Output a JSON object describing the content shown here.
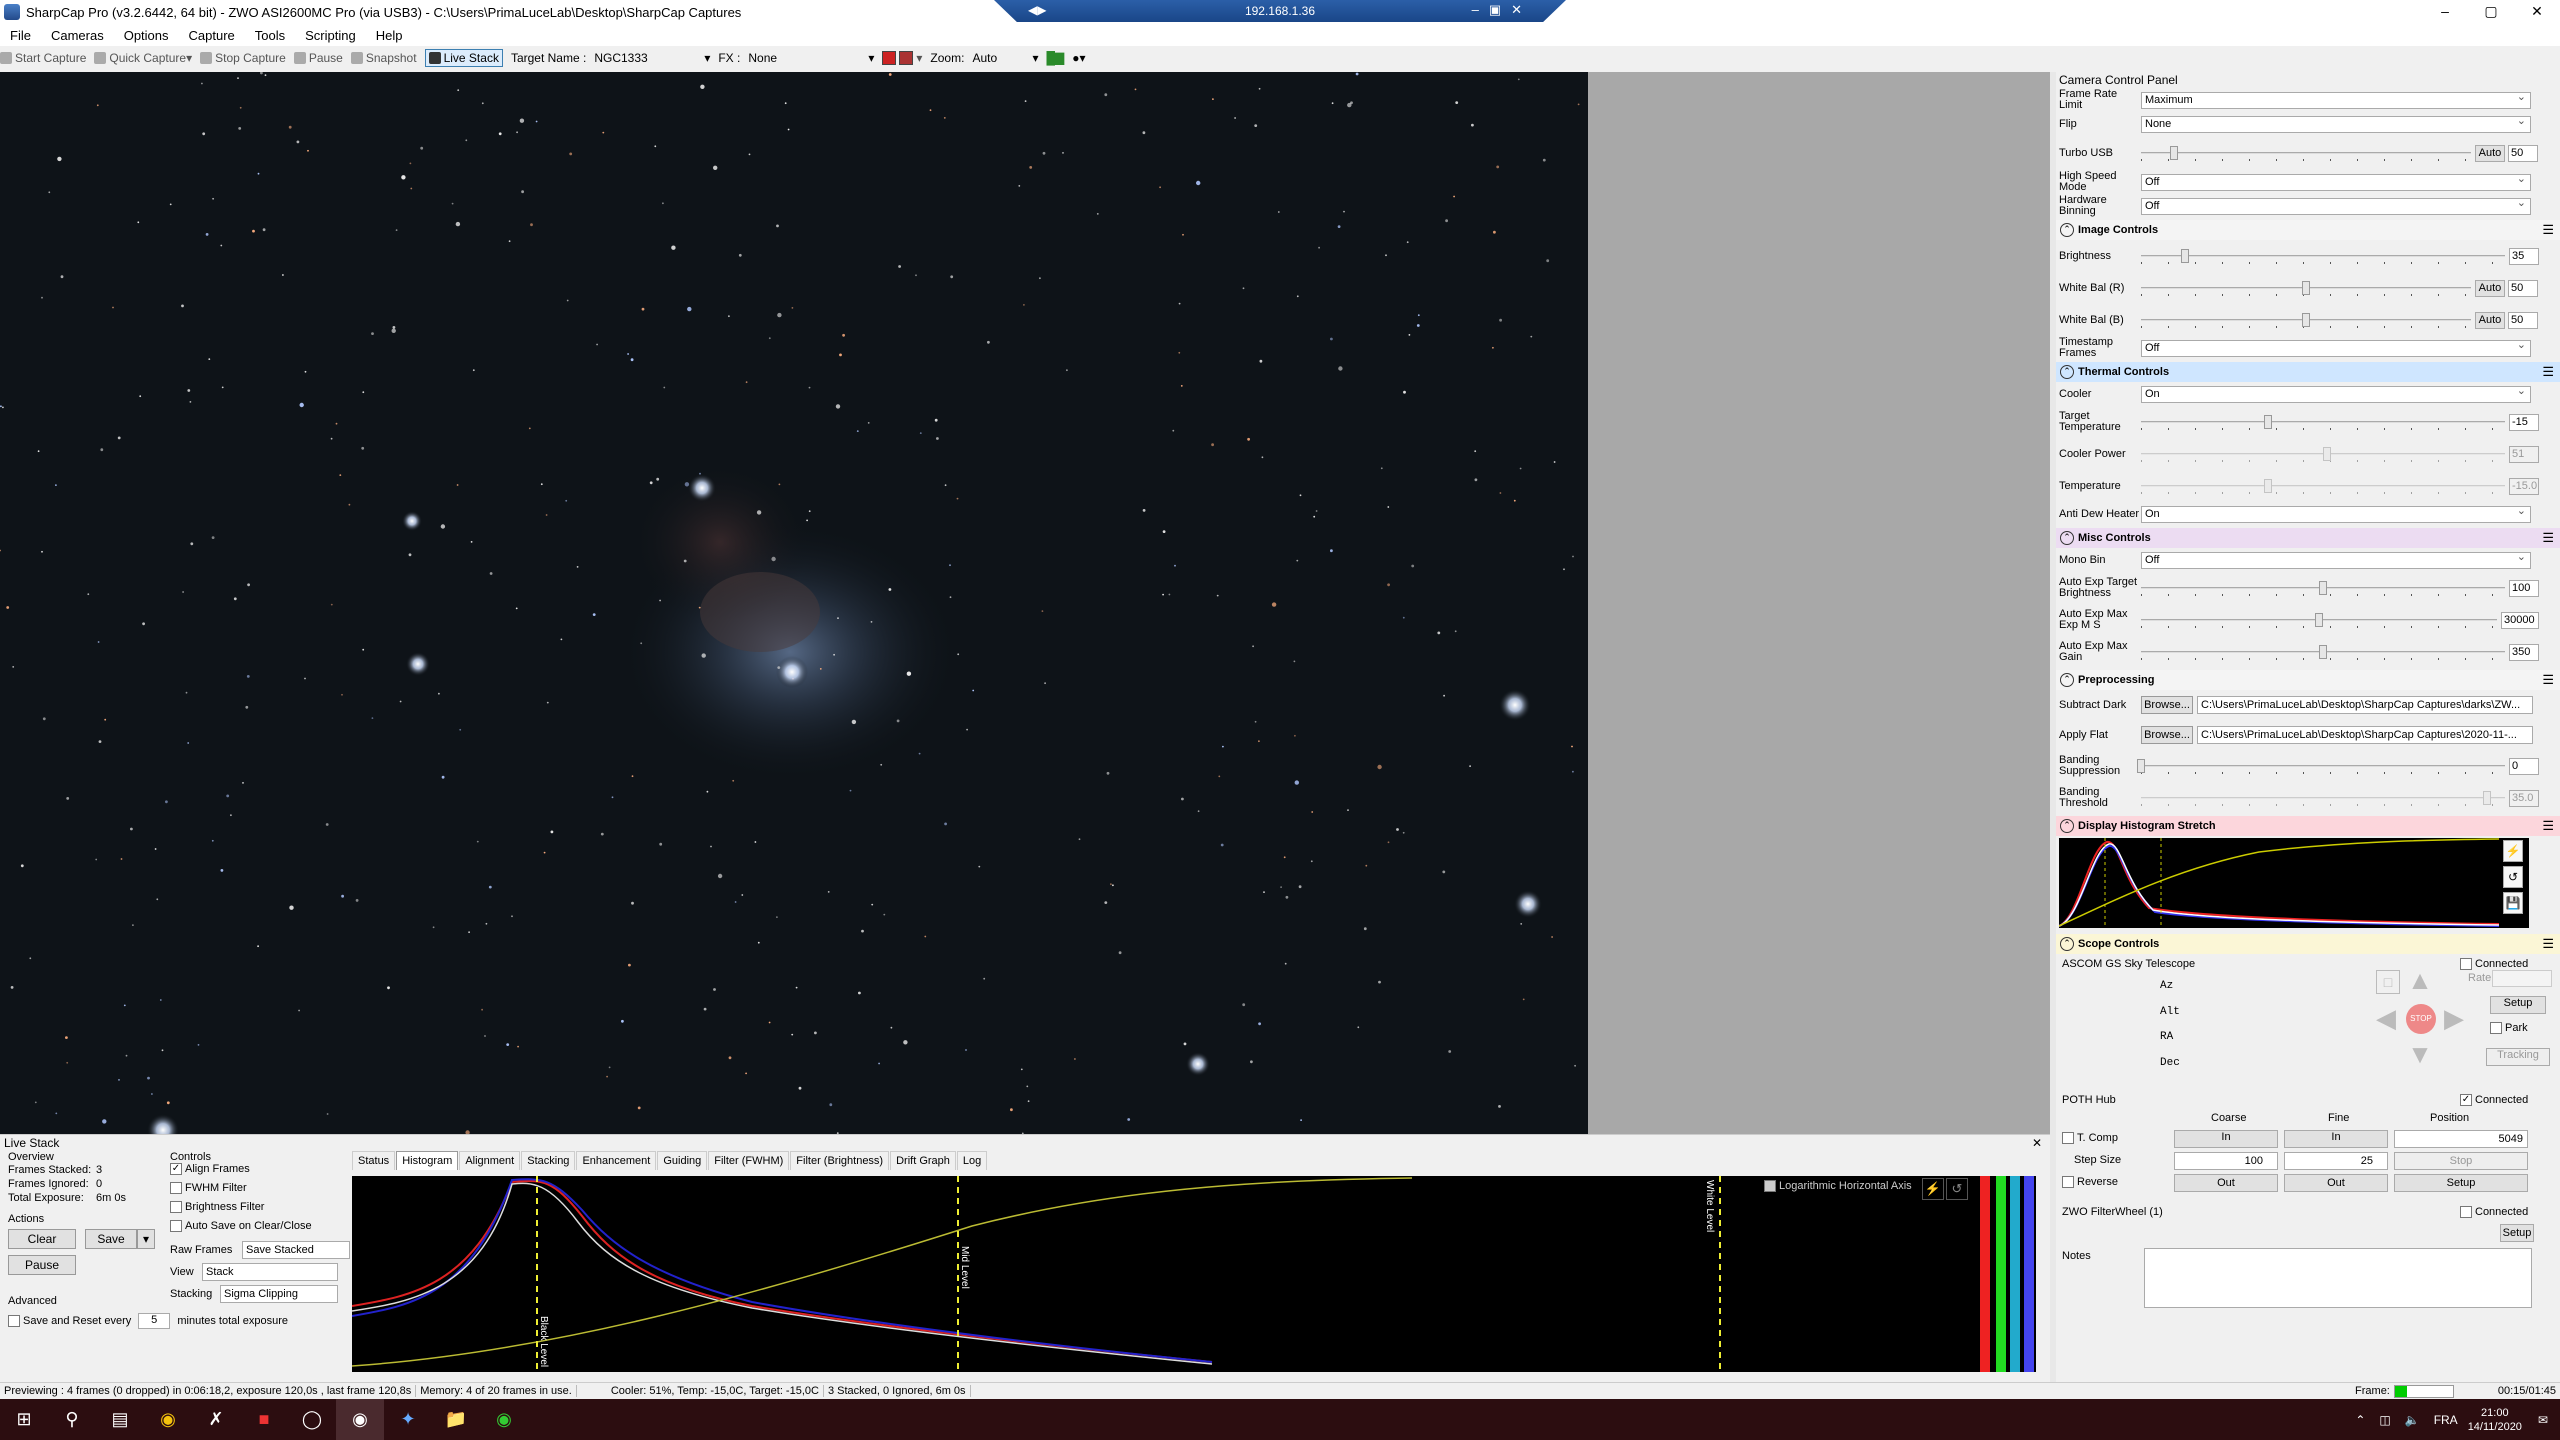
{
  "window": {
    "title": "SharpCap Pro (v3.2.6442, 64 bit) - ZWO ASI2600MC Pro (via USB3) - C:\\Users\\PrimaLuceLab\\Desktop\\SharpCap Captures",
    "remote_address": "192.168.1.36"
  },
  "menu": [
    "File",
    "Cameras",
    "Options",
    "Capture",
    "Tools",
    "Scripting",
    "Help"
  ],
  "toolbar": {
    "start_capture": "Start Capture",
    "quick_capture": "Quick Capture",
    "stop_capture": "Stop Capture",
    "pause": "Pause",
    "snapshot": "Snapshot",
    "live_stack": "Live Stack",
    "target_name_label": "Target Name :",
    "target_name_value": "NGC1333",
    "fx_label": "FX :",
    "fx_value": "None",
    "zoom_label": "Zoom:",
    "zoom_value": "Auto"
  },
  "ccp": {
    "title": "Camera Control Panel",
    "camera_rows": [
      {
        "label": "Frame Rate Limit",
        "value": "Maximum"
      },
      {
        "label": "Flip",
        "value": "None"
      }
    ],
    "turbo_usb": {
      "label": "Turbo USB",
      "auto": "Auto",
      "value": "50",
      "level": 0.1
    },
    "high_speed": {
      "label": "High Speed Mode",
      "value": "Off"
    },
    "hw_binning": {
      "label": "Hardware Binning",
      "value": "Off"
    },
    "image_controls": {
      "title": "Image Controls",
      "brightness": {
        "label": "Brightness",
        "value": "35",
        "level": 0.12
      },
      "wb_r": {
        "label": "White Bal (R)",
        "auto": "Auto",
        "value": "50",
        "level": 0.5
      },
      "wb_b": {
        "label": "White Bal (B)",
        "auto": "Auto",
        "value": "50",
        "level": 0.5
      },
      "timestamp": {
        "label": "Timestamp Frames",
        "value": "Off"
      }
    },
    "thermal": {
      "title": "Thermal Controls",
      "cooler": {
        "label": "Cooler",
        "value": "On"
      },
      "target_temp": {
        "label": "Target Temperature",
        "value": "-15",
        "level": 0.35
      },
      "cooler_power": {
        "label": "Cooler Power",
        "value": "51",
        "level": 0.51
      },
      "temperature": {
        "label": "Temperature",
        "value": "-15.0",
        "level": 0.35
      },
      "anti_dew": {
        "label": "Anti Dew Heater",
        "value": "On"
      }
    },
    "misc": {
      "title": "Misc Controls",
      "mono_bin": {
        "label": "Mono Bin",
        "value": "Off"
      },
      "ae_target": {
        "label": "Auto Exp Target Brightness",
        "value": "100",
        "level": 0.5
      },
      "ae_max_exp": {
        "label": "Auto Exp Max Exp M S",
        "value": "30000",
        "level": 0.5
      },
      "ae_max_gain": {
        "label": "Auto Exp Max Gain",
        "value": "350",
        "level": 0.5
      }
    },
    "pre": {
      "title": "Preprocessing",
      "subtract_dark": {
        "label": "Subtract Dark",
        "button": "Browse...",
        "path": "C:\\Users\\PrimaLuceLab\\Desktop\\SharpCap Captures\\darks\\ZW..."
      },
      "apply_flat": {
        "label": "Apply Flat",
        "button": "Browse...",
        "path": "C:\\Users\\PrimaLuceLab\\Desktop\\SharpCap Captures\\2020-11-..."
      },
      "banding_supp": {
        "label": "Banding Suppression",
        "value": "0",
        "level": 0.0
      },
      "banding_thr": {
        "label": "Banding Threshold",
        "value": "35.0",
        "level": 0.95
      }
    },
    "hist": {
      "title": "Display Histogram Stretch"
    },
    "scope": {
      "title": "Scope Controls",
      "telescope": "ASCOM GS Sky Telescope",
      "connected": "Connected",
      "axes": [
        "Az",
        "Alt",
        "RA",
        "Dec"
      ],
      "rate": "Rate:",
      "setup": "Setup",
      "park": "Park",
      "tracking": "Tracking",
      "stop": "STOP"
    },
    "focuser": {
      "name": "POTH Hub",
      "connected": "Connected",
      "coarse": "Coarse",
      "fine": "Fine",
      "position": "Position",
      "tcomp": "T. Comp",
      "in": "In",
      "position_value": "5049",
      "step_size": "Step Size",
      "coarse_step": "100",
      "fine_step": "25",
      "stop": "Stop",
      "reverse": "Reverse",
      "out": "Out",
      "setup": "Setup"
    },
    "filterwheel": {
      "name": "ZWO FilterWheel (1)",
      "connected": "Connected",
      "setup": "Setup"
    },
    "notes": "Notes"
  },
  "livestack": {
    "title": "Live Stack",
    "overview": "Overview",
    "frames_stacked": {
      "label": "Frames Stacked:",
      "value": "3"
    },
    "frames_ignored": {
      "label": "Frames Ignored:",
      "value": "0"
    },
    "total_exposure": {
      "label": "Total Exposure:",
      "value": "6m 0s"
    },
    "actions": "Actions",
    "clear": "Clear",
    "save": "Save",
    "pause": "Pause",
    "advanced": "Advanced",
    "save_reset": "Save and Reset every",
    "save_reset_value": "5",
    "minutes_total": "minutes total exposure",
    "controls": "Controls",
    "align_frames": "Align Frames",
    "fwhm_filter": "FWHM Filter",
    "brightness_filter": "Brightness Filter",
    "auto_save": "Auto Save on Clear/Close",
    "raw_frames": {
      "label": "Raw Frames",
      "value": "Save Stacked"
    },
    "view": {
      "label": "View",
      "value": "Stack"
    },
    "stacking": {
      "label": "Stacking",
      "value": "Sigma Clipping"
    },
    "tabs": [
      "Status",
      "Histogram",
      "Alignment",
      "Stacking",
      "Enhancement",
      "Guiding",
      "Filter (FWHM)",
      "Filter (Brightness)",
      "Drift Graph",
      "Log"
    ],
    "active_tab": "Histogram",
    "log_axis": "Logarithmic Horizontal Axis",
    "black_level": "Black Level",
    "mid_level": "Mid Level",
    "white_level": "White Level"
  },
  "status": {
    "preview": "Previewing : 4 frames (0 dropped) in 0:06:18,2, exposure 120,0s , last frame 120,8s",
    "memory": "Memory: 4 of 20 frames in use.",
    "cooler": "Cooler: 51%, Temp: -15,0C, Target: -15,0C",
    "stack": "3 Stacked, 0 Ignored, 6m 0s",
    "frame_label": "Frame:",
    "timer": "00:15/01:45"
  },
  "taskbar": {
    "lang": "FRA",
    "time": "21:00",
    "date": "14/11/2020"
  }
}
